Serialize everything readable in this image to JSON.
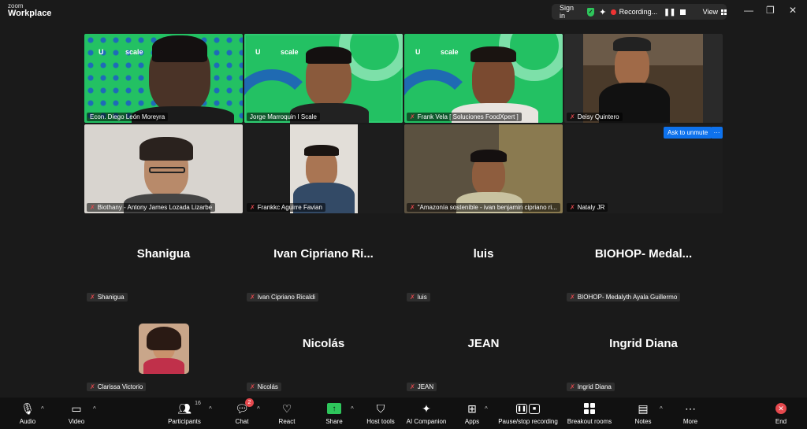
{
  "app": {
    "brand_small": "zoom",
    "brand_name": "Workplace"
  },
  "topbar": {
    "sign_in": "Sign in",
    "recording": "Recording...",
    "view": "View"
  },
  "video_tiles": [
    {
      "name": "Econ. Diego León Moreyra"
    },
    {
      "name": "Jorge Marroquin I Scale"
    },
    {
      "name": "Frank Vela [ Soluciones FoodXpert ]"
    },
    {
      "name": "Deisy Quintero"
    },
    {
      "name": "Biothany - Antony James Lozada Lizarbe"
    },
    {
      "name": "Frankkc Aguirre Favian"
    },
    {
      "name": "\"Amazonía sostenible - ivan benjamin cipriano ri..."
    },
    {
      "name": "Nataly JR"
    }
  ],
  "background_text": {
    "brand_u": "U",
    "brand_scale": "scale"
  },
  "ask_to_unmute": "Ask to unmute",
  "more_options": "···",
  "name_tiles": [
    {
      "big": "Shanigua",
      "name": "Shanigua"
    },
    {
      "big": "Ivan Cipriano Ri...",
      "name": "Ivan Cipriano Ricaldi"
    },
    {
      "big": "luis",
      "name": "luis"
    },
    {
      "big": "BIOHOP- Medal...",
      "name": "BIOHOP- Medalyth Ayala Guillermo"
    },
    {
      "big": "",
      "name": "Clarissa Victorio"
    },
    {
      "big": "Nicolás",
      "name": "Nicolás"
    },
    {
      "big": "JEAN",
      "name": "JEAN"
    },
    {
      "big": "Ingrid Diana",
      "name": "Ingrid Diana"
    }
  ],
  "toolbar": {
    "audio": "Audio",
    "video": "Video",
    "participants": "Participants",
    "participants_count": "16",
    "chat": "Chat",
    "chat_badge": "2",
    "react": "React",
    "share": "Share",
    "host_tools": "Host tools",
    "ai_companion": "AI Companion",
    "apps": "Apps",
    "pause_stop": "Pause/stop recording",
    "breakout": "Breakout rooms",
    "notes": "Notes",
    "more": "More",
    "end": "End"
  },
  "colors": {
    "accent_green": "#23c163",
    "active_border": "#2ecc71",
    "unmute_blue": "#0e72ed",
    "end_red": "#e5484d"
  }
}
